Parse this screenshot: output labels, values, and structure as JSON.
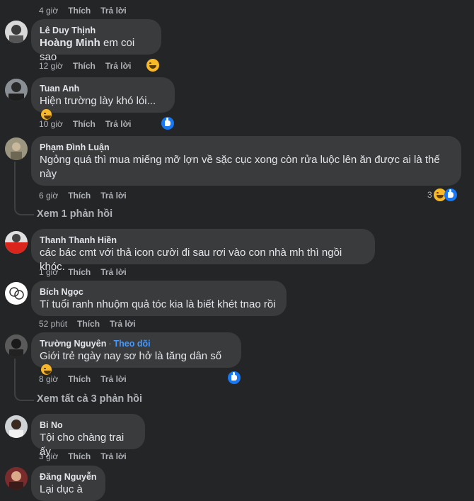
{
  "actions": {
    "like": "Thích",
    "reply": "Trả lời"
  },
  "follow_label": "Theo dõi",
  "comments": [
    {
      "time": "4 giờ"
    },
    {
      "name": "Lê Duy Thịnh",
      "mention": "Hoàng Minh",
      "text": " em coi sao",
      "time": "12 giờ"
    },
    {
      "name": "Tuan Anh",
      "text": "Hiện trường lày khó lói...",
      "time": "10 giờ"
    },
    {
      "name": "Phạm Đình Luận",
      "text": "Ngỏng quá thì mua miếng mỡ lợn về sặc cục xong còn rửa luộc lên ăn được ai là thế này",
      "time": "6 giờ",
      "reaction_count": "3"
    },
    {
      "name": "Thanh Thanh Hiền",
      "text": "các bác cmt với thả icon cười đi sau rơi vào con nhà mh thì ngồi khóc.",
      "time": "1 giờ"
    },
    {
      "name": "Bích Ngọc",
      "text": "Tí tuổi ranh nhuộm quả tóc kia là biết khét tnao rồi",
      "time": "52 phút"
    },
    {
      "name": "Trường Nguyên",
      "text": "Giới trẻ ngày nay sơ hở là tăng dân số",
      "time": "8 giờ"
    },
    {
      "name": "Bi No",
      "text": "Tội cho chàng trai ấy",
      "time": "3 giờ"
    },
    {
      "name": "Đăng Nguyễn",
      "text": "Lại dục à"
    }
  ],
  "replies_links": [
    "Xem 1 phản hồi",
    "Xem tất cả 3 phản hồi"
  ],
  "separator": "·",
  "colors": {
    "background": "#242526",
    "bubble": "#3a3b3c",
    "meta": "#b0b3b8",
    "link": "#4599ff",
    "haha": "#f7b928",
    "like": "#1877f2"
  }
}
